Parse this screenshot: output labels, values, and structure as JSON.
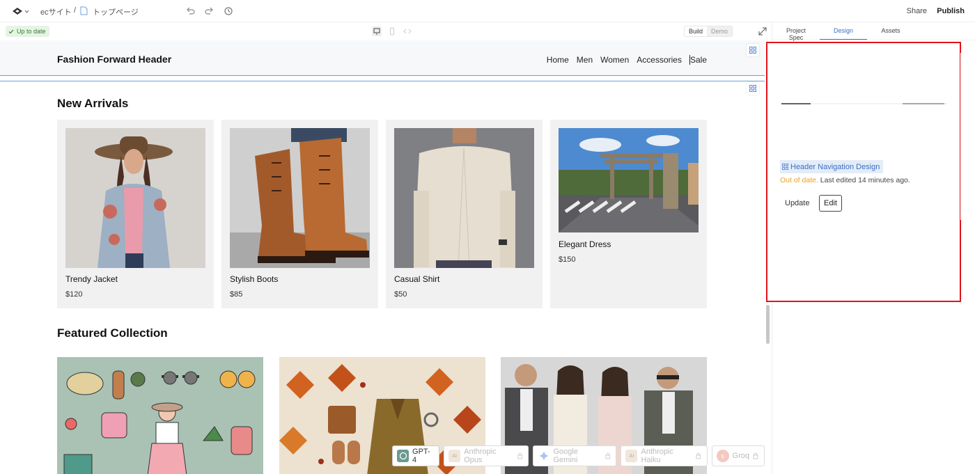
{
  "topbar": {
    "project": "ecサイト",
    "separator": "/",
    "page": "トップページ",
    "share": "Share",
    "publish": "Publish"
  },
  "subbar": {
    "status": "Up to date",
    "modes": [
      "Build",
      "Demo"
    ]
  },
  "site": {
    "brand": "Fashion Forward Header",
    "nav": [
      "Home",
      "Men",
      "Women",
      "Accessories",
      "Sale"
    ],
    "new_arrivals_title": "New Arrivals",
    "products": [
      {
        "name": "Trendy Jacket",
        "price": "$120"
      },
      {
        "name": "Stylish Boots",
        "price": "$85"
      },
      {
        "name": "Casual Shirt",
        "price": "$50"
      },
      {
        "name": "Elegant Dress",
        "price": "$150"
      }
    ],
    "featured_title": "Featured Collection"
  },
  "models": [
    {
      "name": "GPT-4",
      "locked": false
    },
    {
      "name": "Anthropic Opus",
      "locked": true
    },
    {
      "name": "Google Gemini",
      "locked": true
    },
    {
      "name": "Anthropic Haiku",
      "locked": true
    },
    {
      "name": "Groq",
      "locked": true
    }
  ],
  "panel": {
    "tabs": [
      "Project Spec",
      "Design",
      "Assets"
    ],
    "active_tab": "Design",
    "component": "Header Navigation Design",
    "status_out": "Out of date.",
    "status_rest": " Last edited 14 minutes ago.",
    "update": "Update",
    "edit": "Edit"
  },
  "colors": {
    "accent": "#3a72c7",
    "highlight": "#e3121b",
    "warning": "#e8a020",
    "ok_bg": "#e5f4e3"
  }
}
